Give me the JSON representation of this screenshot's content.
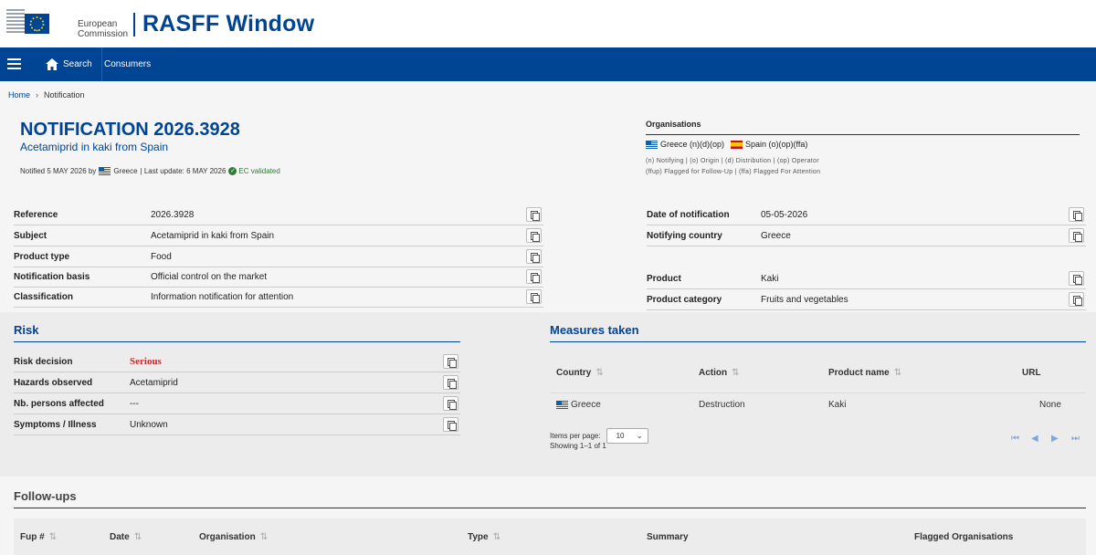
{
  "header": {
    "org_line1": "European",
    "org_line2": "Commission",
    "app_title": "RASFF Window"
  },
  "nav": {
    "search": "Search",
    "consumers": "Consumers"
  },
  "breadcrumb": {
    "home": "Home",
    "current": "Notification"
  },
  "notification": {
    "title": "NOTIFICATION 2026.3928",
    "subtitle": "Acetamiprid in kaki from Spain",
    "notified_prefix": "Notified 5 MAY 2026 by",
    "notified_country": "Greece",
    "last_update": "| Last update: 6 MAY 2026",
    "validated": "EC validated"
  },
  "organisations": {
    "heading": "Organisations",
    "greece": "Greece (n)(d)(op)",
    "spain": "Spain (o)(op)(ffa)",
    "legend1": "(n) Notifying | (o) Origin | (d) Distribution | (op) Operator",
    "legend2": "(ffup) Flagged for Follow-Up | (ffa) Flagged For Attention"
  },
  "details_left": [
    {
      "label": "Reference",
      "value": "2026.3928"
    },
    {
      "label": "Subject",
      "value": "Acetamiprid in kaki from Spain"
    },
    {
      "label": "Product type",
      "value": "Food"
    },
    {
      "label": "Notification basis",
      "value": "Official control on the market"
    },
    {
      "label": "Classification",
      "value": "Information notification for attention"
    }
  ],
  "details_right": [
    {
      "label": "Date of notification",
      "value": "05-05-2026"
    },
    {
      "label": "Notifying country",
      "value": "Greece"
    },
    {
      "label": "Product",
      "value": "Kaki"
    },
    {
      "label": "Product category",
      "value": "Fruits and vegetables"
    }
  ],
  "risk": {
    "title": "Risk",
    "rows": [
      {
        "label": "Risk decision",
        "value": "Serious"
      },
      {
        "label": "Hazards observed",
        "value": "Acetamiprid"
      },
      {
        "label": "Nb. persons affected",
        "value": "---"
      },
      {
        "label": "Symptoms / Illness",
        "value": "Unknown"
      }
    ]
  },
  "measures": {
    "title": "Measures taken",
    "columns": [
      "Country",
      "Action",
      "Product name",
      "URL"
    ],
    "row": {
      "country": "Greece",
      "action": "Destruction",
      "product": "Kaki",
      "url": "None"
    },
    "items_per_page_label": "Items per page:",
    "items_per_page": "10",
    "showing": "Showing 1–1 of 1"
  },
  "followups": {
    "title": "Follow-ups",
    "columns": [
      "Fup #",
      "Date",
      "Organisation",
      "Type",
      "Summary",
      "Flagged Organisations"
    ]
  }
}
